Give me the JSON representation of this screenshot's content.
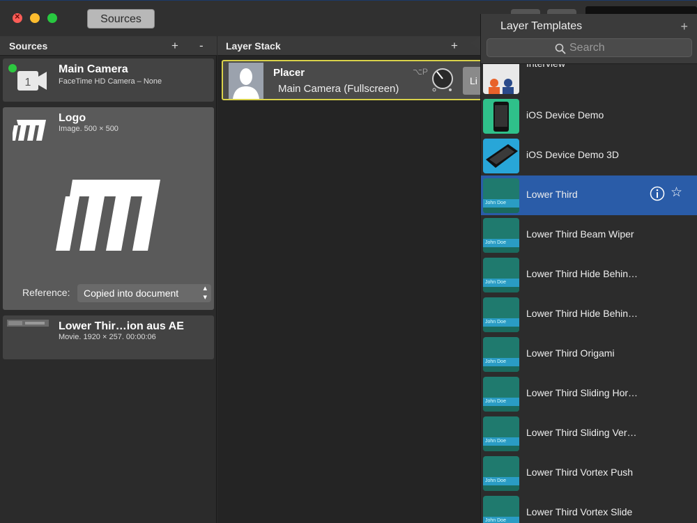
{
  "toolbar": {
    "sources_label": "Sources"
  },
  "sources_panel": {
    "header": "Sources",
    "add_symbol": "+",
    "remove_symbol": "-",
    "items": [
      {
        "title": "Main Camera",
        "subtitle": "FaceTime HD Camera – None",
        "badge": "1"
      },
      {
        "title": "Logo",
        "subtitle": "Image. 500 × 500",
        "reference_label": "Reference:",
        "reference_value": "Copied into document"
      },
      {
        "title": "Lower Thir…ion aus AE",
        "subtitle": "Movie. 1920 × 257. 00:00:06"
      }
    ]
  },
  "layer_stack": {
    "header": "Layer Stack",
    "add_symbol": "+",
    "layer": {
      "title": "Placer",
      "subtitle": "Main Camera (Fullscreen)",
      "shortcut": "⌥P",
      "live_label": "Li"
    }
  },
  "templates": {
    "title": "Layer Templates",
    "add_symbol": "+",
    "search_placeholder": "Search",
    "items": [
      {
        "label": "Interview",
        "thumb": "interview"
      },
      {
        "label": "iOS Device Demo",
        "thumb": "ios"
      },
      {
        "label": "iOS Device Demo 3D",
        "thumb": "ios3d"
      },
      {
        "label": "Lower Third",
        "thumb": "lower",
        "thumb_text": "John Doe",
        "selected": true
      },
      {
        "label": "Lower Third Beam Wiper",
        "thumb": "lower",
        "thumb_text": "John Doe"
      },
      {
        "label": "Lower Third Hide Behin…",
        "thumb": "lower",
        "thumb_text": "John Doe"
      },
      {
        "label": "Lower Third Hide Behin…",
        "thumb": "lower",
        "thumb_text": "John Doe"
      },
      {
        "label": "Lower Third Origami",
        "thumb": "lower",
        "thumb_text": "John Doe"
      },
      {
        "label": "Lower Third Sliding Hor…",
        "thumb": "lower",
        "thumb_text": "John Doe"
      },
      {
        "label": "Lower Third Sliding Ver…",
        "thumb": "lower",
        "thumb_text": "John Doe"
      },
      {
        "label": "Lower Third Vortex Push",
        "thumb": "lower",
        "thumb_text": "John Doe"
      },
      {
        "label": "Lower Third Vortex Slide",
        "thumb": "lower",
        "thumb_text": "John Doe"
      }
    ],
    "selected_info_icon": "info-icon",
    "selected_star_icon": "star-icon"
  },
  "colors": {
    "accent": "#2a5ca8",
    "live_border": "#d9d14a",
    "camera_active": "#2dc840"
  }
}
